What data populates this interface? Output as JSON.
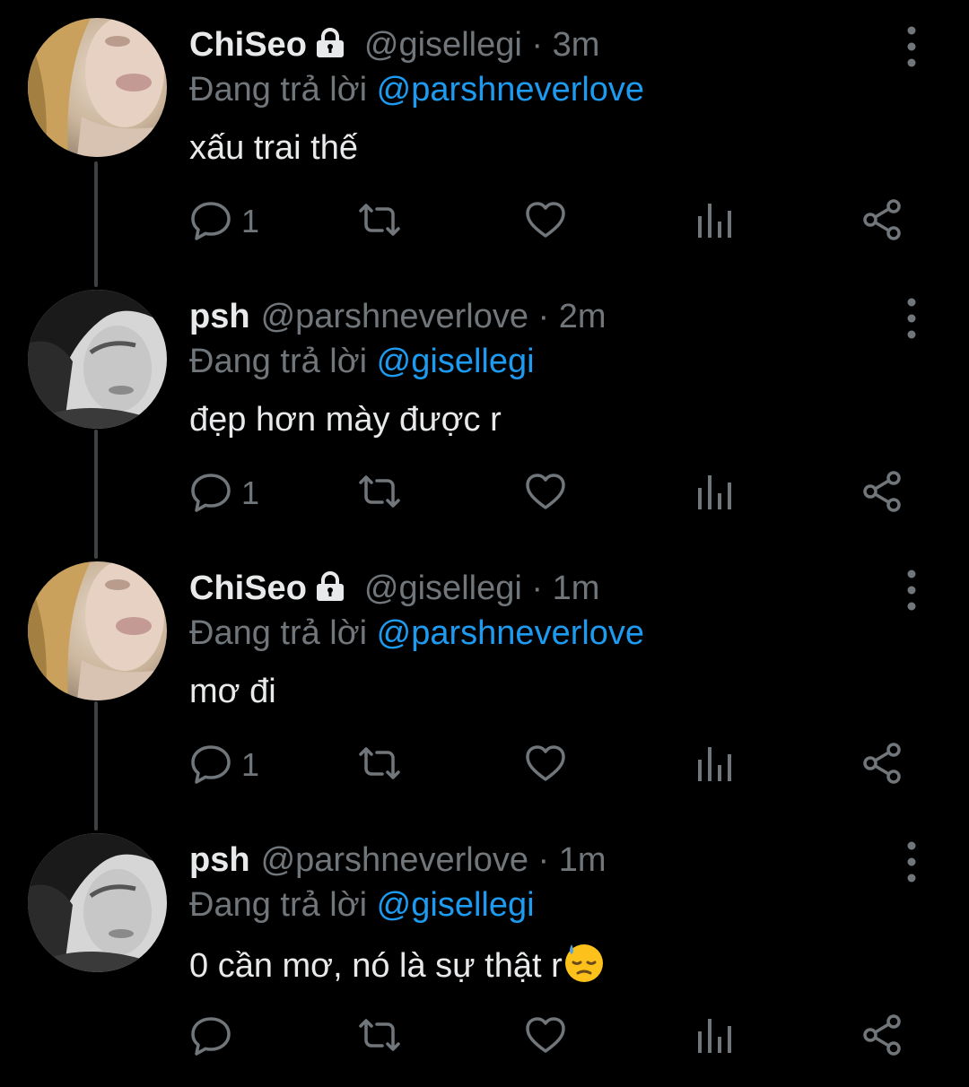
{
  "theme": {
    "background": "#000000",
    "text_primary": "#e7e9ea",
    "text_secondary": "#71767b",
    "link": "#1d9bf0",
    "thread_line": "#3e4144"
  },
  "tweets": [
    {
      "display_name": "ChiSeo",
      "protected": true,
      "handle": "@gisellegi",
      "separator": "·",
      "time": "3m",
      "reply_prefix": "Đang trả lời",
      "reply_to": "@parshneverlove",
      "text": "xấu trai thế",
      "emoji": "",
      "reply_count": "1",
      "avatar_icon": "blonde-woman-avatar"
    },
    {
      "display_name": "psh",
      "protected": false,
      "handle": "@parshneverlove",
      "separator": "·",
      "time": "2m",
      "reply_prefix": "Đang trả lời",
      "reply_to": "@gisellegi",
      "text": "đẹp hơn mày được r",
      "emoji": "",
      "reply_count": "1",
      "avatar_icon": "monochrome-man-avatar"
    },
    {
      "display_name": "ChiSeo",
      "protected": true,
      "handle": "@gisellegi",
      "separator": "·",
      "time": "1m",
      "reply_prefix": "Đang trả lời",
      "reply_to": "@parshneverlove",
      "text": "mơ đi",
      "emoji": "",
      "reply_count": "1",
      "avatar_icon": "blonde-woman-avatar"
    },
    {
      "display_name": "psh",
      "protected": false,
      "handle": "@parshneverlove",
      "separator": "·",
      "time": "1m",
      "reply_prefix": "Đang trả lời",
      "reply_to": "@gisellegi",
      "text": "0 cần mơ, nó là sự thật r",
      "emoji": "downcast-face-with-sweat",
      "reply_count": "",
      "avatar_icon": "monochrome-man-avatar"
    }
  ],
  "icons": {
    "reply": "reply-icon",
    "retweet": "retweet-icon",
    "like": "heart-icon",
    "views": "views-chart-icon",
    "share": "share-icon",
    "more": "more-vertical-icon",
    "lock": "lock-icon"
  }
}
